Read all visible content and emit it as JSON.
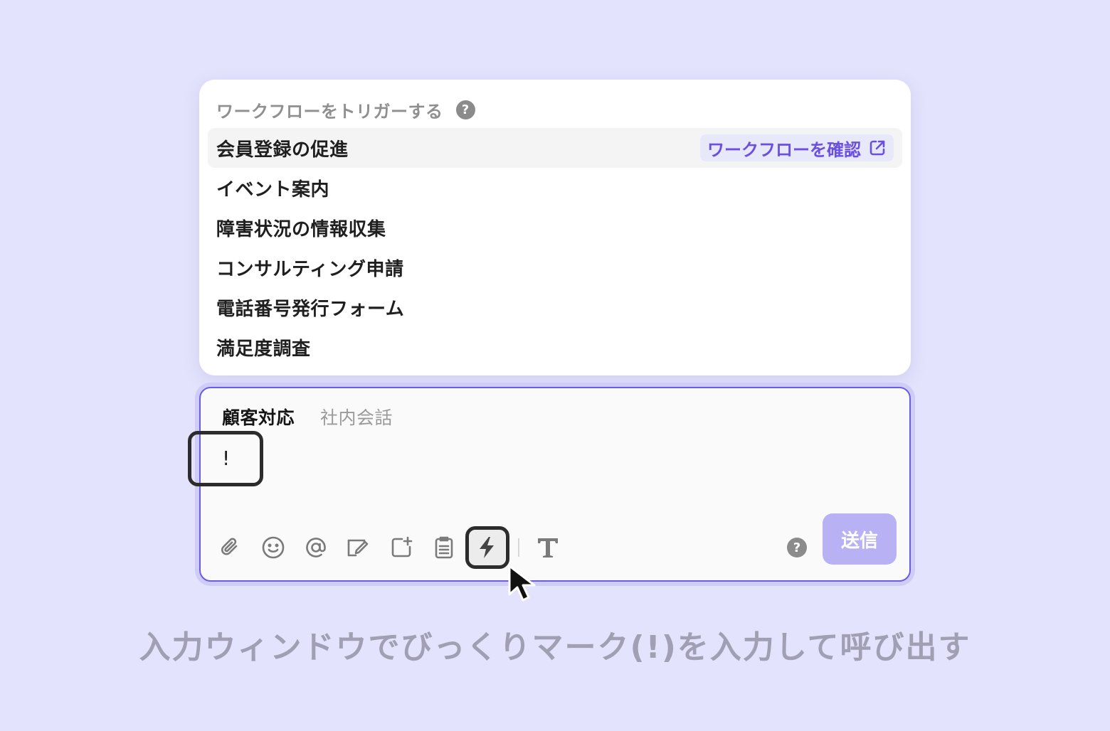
{
  "popup": {
    "title": "ワークフローをトリガーする",
    "help_glyph": "?",
    "items": [
      {
        "label": "会員登録の促進"
      },
      {
        "label": "イベント案内"
      },
      {
        "label": "障害状況の情報収集"
      },
      {
        "label": "コンサルティング申請"
      },
      {
        "label": "電話番号発行フォーム"
      },
      {
        "label": "満足度調査"
      }
    ],
    "confirm_link": "ワークフローを確認",
    "confirm_icon": "external-link-icon"
  },
  "composer": {
    "tabs": [
      {
        "label": "顧客対応",
        "active": true
      },
      {
        "label": "社内会話",
        "active": false
      }
    ],
    "input_value": "!",
    "toolbar_icons": [
      "paperclip-icon",
      "emoji-icon",
      "mention-icon",
      "template-edit-icon",
      "add-item-icon",
      "clipboard-icon",
      "lightning-icon",
      "text-format-icon"
    ],
    "help_glyph": "?",
    "send_label": "送信"
  },
  "caption": "入力ウィンドウでびっくりマーク(!)を入力して呼び出す",
  "colors": {
    "background": "#e3e3fd",
    "accent": "#6b5ce6",
    "send_button": "#b8b2f5",
    "link": "#6a4fe0"
  }
}
